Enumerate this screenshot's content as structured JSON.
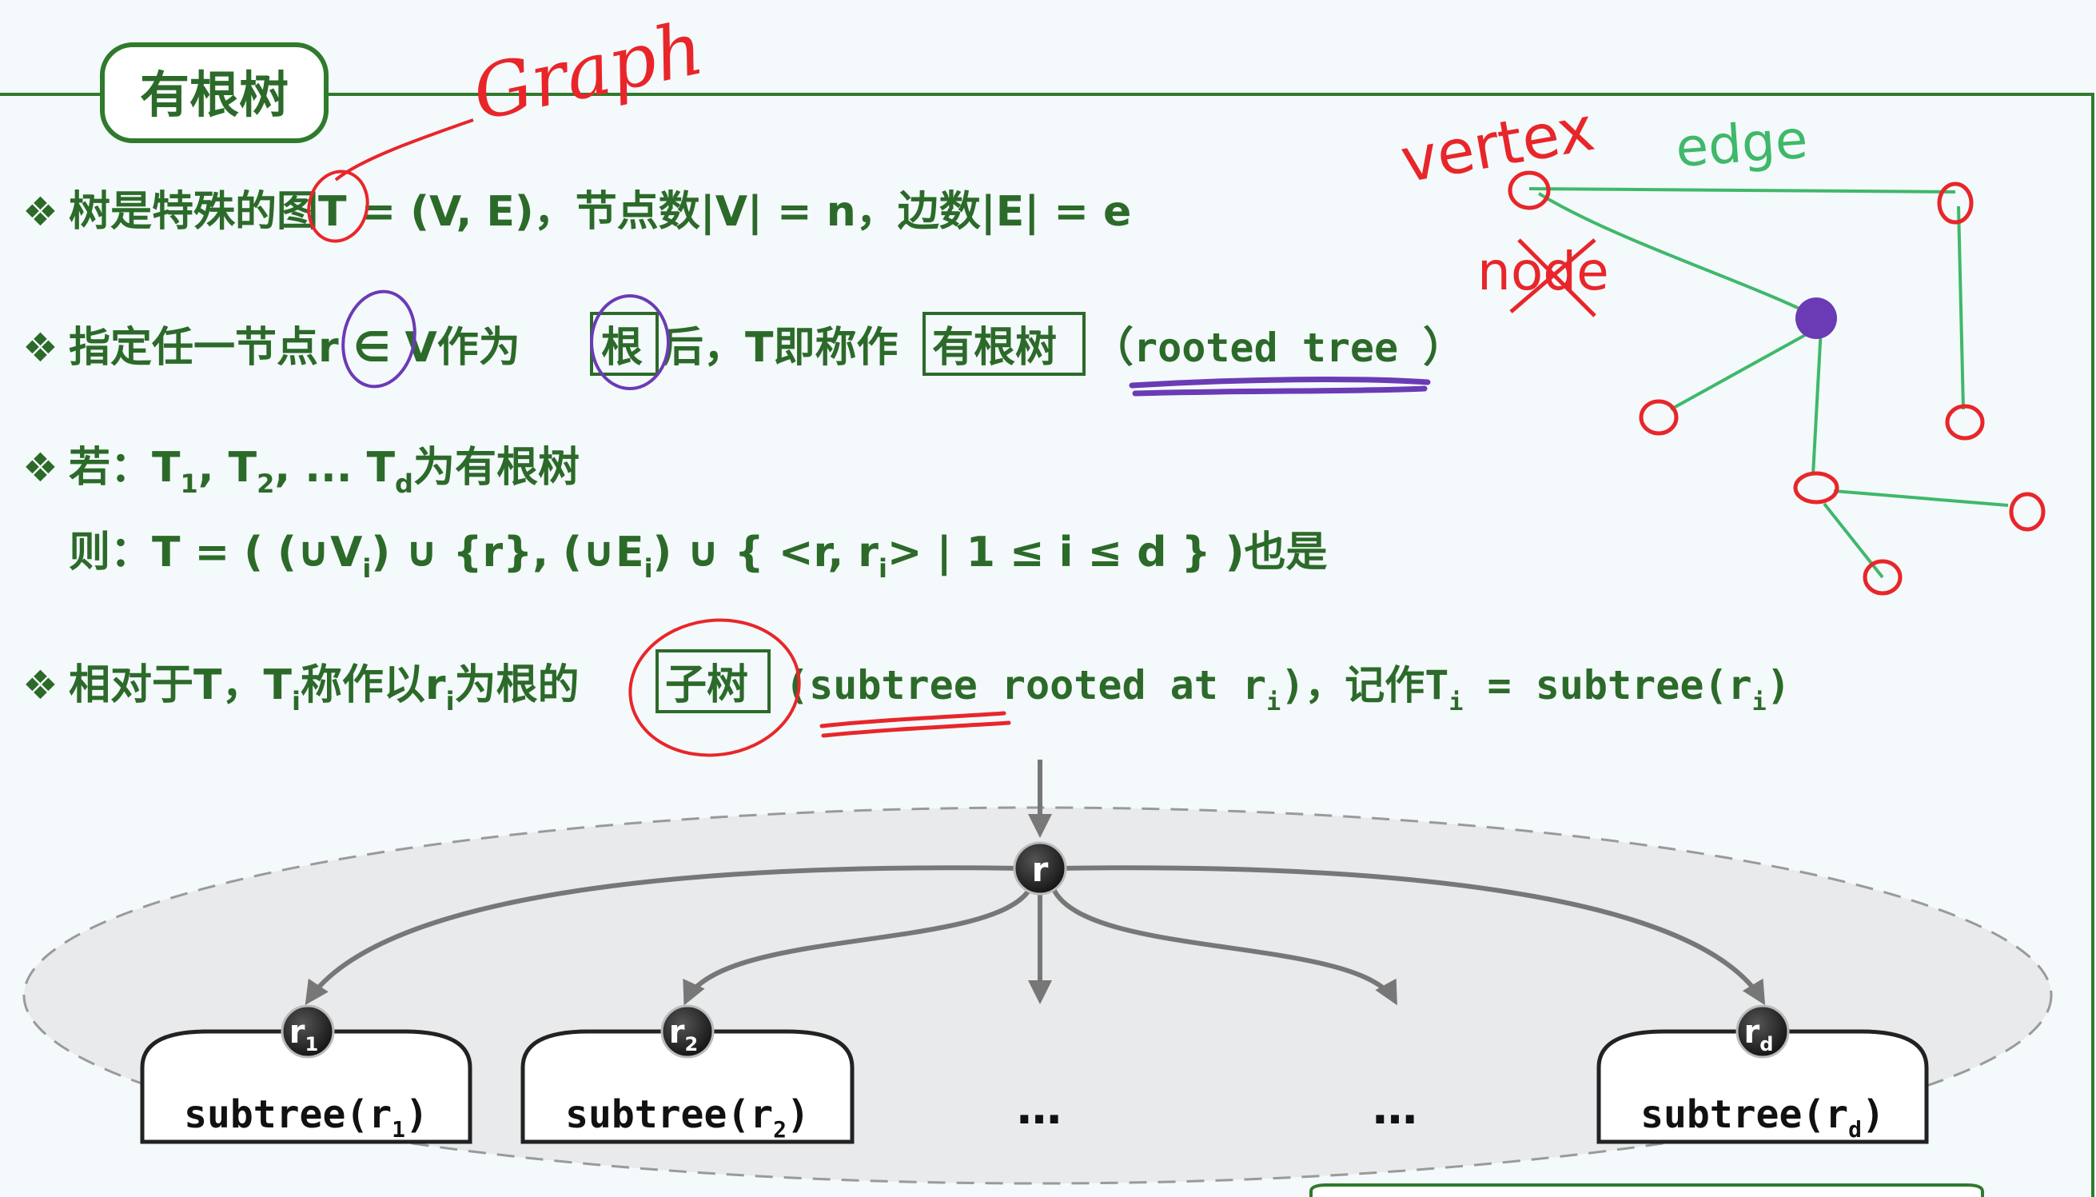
{
  "slide": {
    "title": "有根树",
    "bullet_glyph": "❖",
    "lines": {
      "l1_a": "树是特殊的图T = (V, E)，节点数|V| = n，边数|E| = e",
      "l2_a": "指定任一节点r ∈ V作为",
      "l2_root": "根",
      "l2_b": "后，T即称作",
      "l2_rooted": "有根树",
      "l2_paren_open": "（",
      "l2_en": "rooted tree",
      "l2_paren_close": "）",
      "l3_a": "若：T",
      "l3_sub1": "1",
      "l3_b": ", T",
      "l3_sub2": "2",
      "l3_c": ", ... T",
      "l3_subd": "d",
      "l3_d": "为有根树",
      "l4_a": "则：T = ( (∪V",
      "l4_sub": "i",
      "l4_b": ") ∪ {r}, (∪E",
      "l4_sub2": "i",
      "l4_c": ") ∪ { <r, r",
      "l4_sub3": "i",
      "l4_d": "> | 1 ≤ i ≤ d } )也是",
      "l5_a": "相对于T，T",
      "l5_sub": "i",
      "l5_b": "称作以r",
      "l5_sub2": "i",
      "l5_c": "为根的",
      "l5_subtree_box": "子树",
      "l5_paren_open": "(",
      "l5_en1": "subtree",
      "l5_en2": " rooted at r",
      "l5_sub3": "i",
      "l5_paren_close": ")，记作T",
      "l5_sub4": "i",
      "l5_eq": " = subtree(r",
      "l5_sub5": "i",
      "l5_end": ")"
    },
    "handwriting": {
      "graph": "Graph",
      "vertex": "vertex",
      "edge": "edge",
      "node": "node"
    },
    "diagram": {
      "root_label": "r",
      "child_labels": [
        "r",
        "r",
        "r"
      ],
      "child_subs": [
        "1",
        "2",
        "d"
      ],
      "subtree_prefix": "subtree(r",
      "subtree_subs": [
        "1",
        "2",
        "d"
      ],
      "subtree_suffix": ")",
      "ellipsis": "…"
    },
    "colors": {
      "text_green": "#2c6a2a",
      "ink_red": "#e8262a",
      "ink_green": "#3fb86a",
      "ink_purple": "#6b3bb5",
      "diagram_gray": "#7a7a7a"
    }
  }
}
